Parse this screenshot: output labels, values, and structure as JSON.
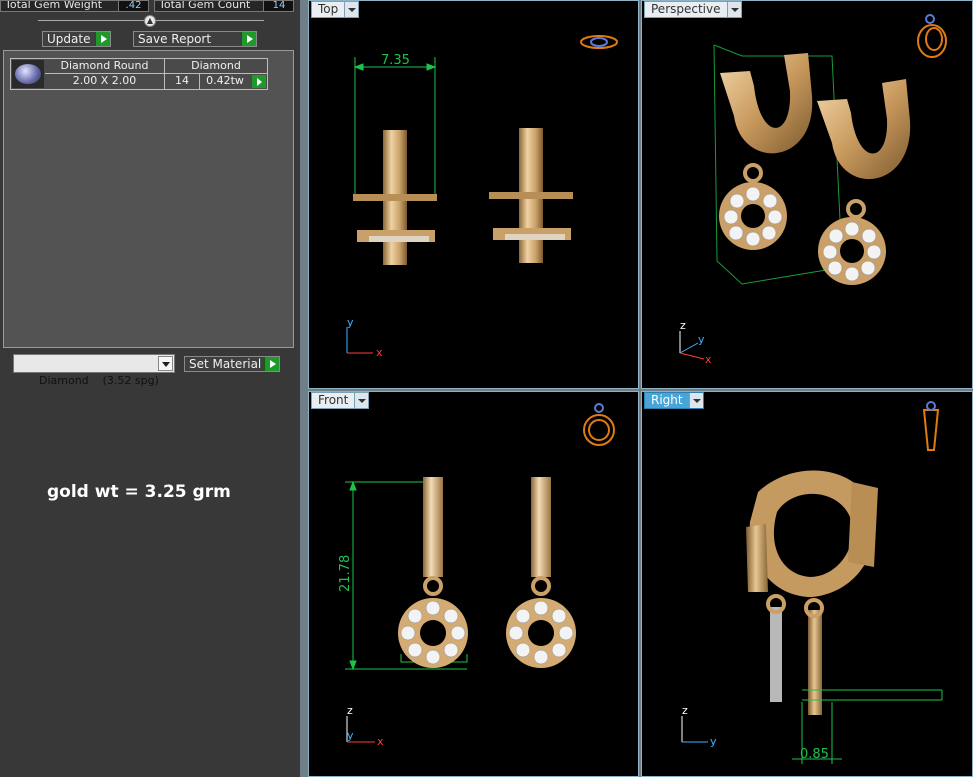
{
  "stats": {
    "weight_label": "Total Gem Weight",
    "weight_value": ".42",
    "count_label": "Total Gem Count",
    "count_value": "14"
  },
  "buttons": {
    "update": "Update",
    "save_report": "Save Report",
    "set_material": "Set Material"
  },
  "gem_table": {
    "headers": [
      "Diamond Round",
      "Diamond"
    ],
    "size": "2.00 X 2.00",
    "count": "14",
    "weight": "0.42tw"
  },
  "material": {
    "selected": "Diamond    (3.52 spg)"
  },
  "note": "gold wt = 3.25 grm",
  "viewports": {
    "top": {
      "label": "Top",
      "dimension": "7.35"
    },
    "perspective": {
      "label": "Perspective"
    },
    "front": {
      "label": "Front",
      "dimension": "21.78"
    },
    "right": {
      "label": "Right",
      "dimension": "0.85"
    }
  },
  "axes": {
    "x": "x",
    "y": "y",
    "z": "z"
  },
  "colors": {
    "gold": "#d8b079",
    "gold_dark": "#9d7642",
    "dimension": "#1ec24a",
    "active_tab": "#47a5d8"
  }
}
